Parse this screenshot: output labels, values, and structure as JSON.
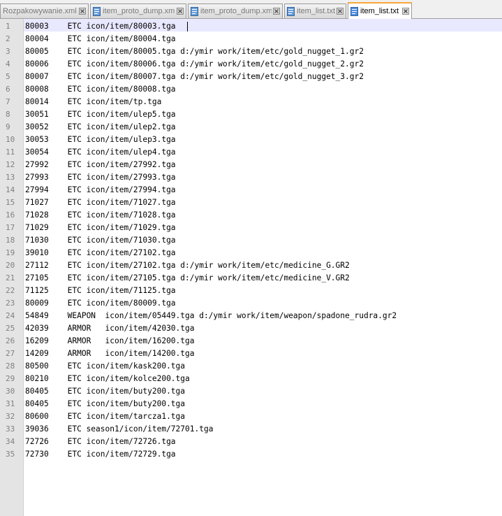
{
  "tabs": [
    {
      "label": "Rozpakowywanie.xml",
      "active": false,
      "icon": "close-icon"
    },
    {
      "label": "item_proto_dump.xml",
      "active": false,
      "icon": "file-icon"
    },
    {
      "label": "item_proto_dump.xml",
      "active": false,
      "icon": "file-icon"
    },
    {
      "label": "item_list.txt",
      "active": false,
      "icon": "file-icon"
    },
    {
      "label": "item_list.txt",
      "active": true,
      "icon": "file-icon"
    }
  ],
  "colors": {
    "active_tab_accent": "#f8a53a",
    "gutter": "#e4e4e4",
    "current_line": "#e8e8ff",
    "line_number": "#808080"
  },
  "lines": [
    "80003\tETC icon/item/80003.tga",
    "80004\tETC icon/item/80004.tga",
    "80005\tETC icon/item/80005.tga d:/ymir work/item/etc/gold_nugget_1.gr2",
    "80006\tETC icon/item/80006.tga d:/ymir work/item/etc/gold_nugget_2.gr2",
    "80007\tETC icon/item/80007.tga d:/ymir work/item/etc/gold_nugget_3.gr2",
    "80008\tETC icon/item/80008.tga",
    "80014\tETC icon/item/tp.tga",
    "30051\tETC icon/item/ulep5.tga",
    "30052\tETC icon/item/ulep2.tga",
    "30053\tETC icon/item/ulep3.tga",
    "30054\tETC icon/item/ulep4.tga",
    "27992\tETC icon/item/27992.tga",
    "27993\tETC icon/item/27993.tga",
    "27994\tETC icon/item/27994.tga",
    "71027\tETC icon/item/71027.tga",
    "71028\tETC icon/item/71028.tga",
    "71029\tETC icon/item/71029.tga",
    "71030\tETC icon/item/71030.tga",
    "39010\tETC icon/item/27102.tga",
    "27112\tETC icon/item/27102.tga d:/ymir work/item/etc/medicine_G.GR2",
    "27105\tETC icon/item/27105.tga d:/ymir work/item/etc/medicine_V.GR2",
    "71125\tETC icon/item/71125.tga",
    "80009\tETC icon/item/80009.tga",
    "54849\tWEAPON  icon/item/05449.tga d:/ymir work/item/weapon/spadone_rudra.gr2",
    "42039\tARMOR   icon/item/42030.tga",
    "16209\tARMOR   icon/item/16200.tga",
    "14209\tARMOR   icon/item/14200.tga",
    "80500\tETC icon/item/kask200.tga",
    "80210\tETC icon/item/kolce200.tga",
    "80405\tETC icon/item/buty200.tga",
    "80405\tETC icon/item/buty200.tga",
    "80600\tETC icon/item/tarcza1.tga",
    "39036\tETC season1/icon/item/72701.tga",
    "72726\tETC icon/item/72726.tga",
    "72730\tETC icon/item/72729.tga"
  ],
  "line_numbers": [
    "1",
    "2",
    "3",
    "4",
    "5",
    "6",
    "7",
    "8",
    "9",
    "10",
    "11",
    "12",
    "13",
    "14",
    "15",
    "16",
    "17",
    "18",
    "19",
    "20",
    "21",
    "22",
    "23",
    "24",
    "25",
    "26",
    "27",
    "28",
    "29",
    "30",
    "31",
    "32",
    "33",
    "34",
    "35"
  ]
}
